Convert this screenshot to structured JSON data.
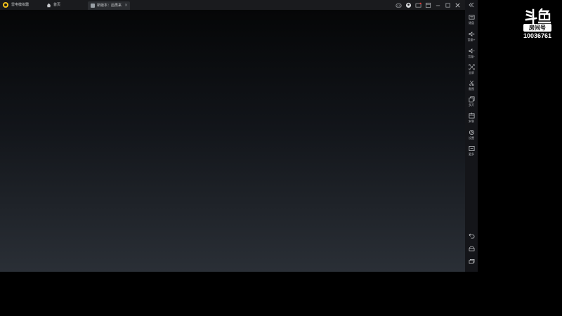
{
  "emulator": {
    "app_name": "雷电模拟器",
    "tabs": [
      {
        "label": "首页",
        "icon": "home-icon"
      },
      {
        "label": "新版本：后再来",
        "icon": "game-icon",
        "close": "×"
      }
    ],
    "title_controls": [
      "gamepad-icon",
      "user-icon",
      "mail-icon",
      "window-icon",
      "minimize-icon",
      "maximize-icon",
      "close-icon"
    ]
  },
  "side_toolbar": {
    "collapse_icon": "double-chevron-left-icon",
    "tools": [
      {
        "label": "键盘",
        "icon": "keyboard-icon"
      },
      {
        "label": "音量+",
        "icon": "volume-up-icon"
      },
      {
        "label": "音量-",
        "icon": "volume-down-icon"
      },
      {
        "label": "全屏",
        "icon": "fullscreen-icon"
      },
      {
        "label": "截图",
        "icon": "scissors-icon"
      },
      {
        "label": "多开",
        "icon": "multi-instance-icon"
      },
      {
        "label": "安装",
        "icon": "install-apk-icon"
      },
      {
        "label": "设置",
        "icon": "settings-icon"
      },
      {
        "label": "更多",
        "icon": "more-icon"
      }
    ],
    "nav": [
      "back-icon",
      "home-icon",
      "recent-apps-icon"
    ]
  },
  "watermark": {
    "logo_text": "斗鱼",
    "room_label": "房间号",
    "room_id": "10036761"
  },
  "colors": {
    "titlebar": "#1a1b1e",
    "toolbar": "#141519",
    "logo_yellow": "#f3c21a",
    "screen_top": "#050607",
    "screen_bottom": "#2a2f36"
  }
}
